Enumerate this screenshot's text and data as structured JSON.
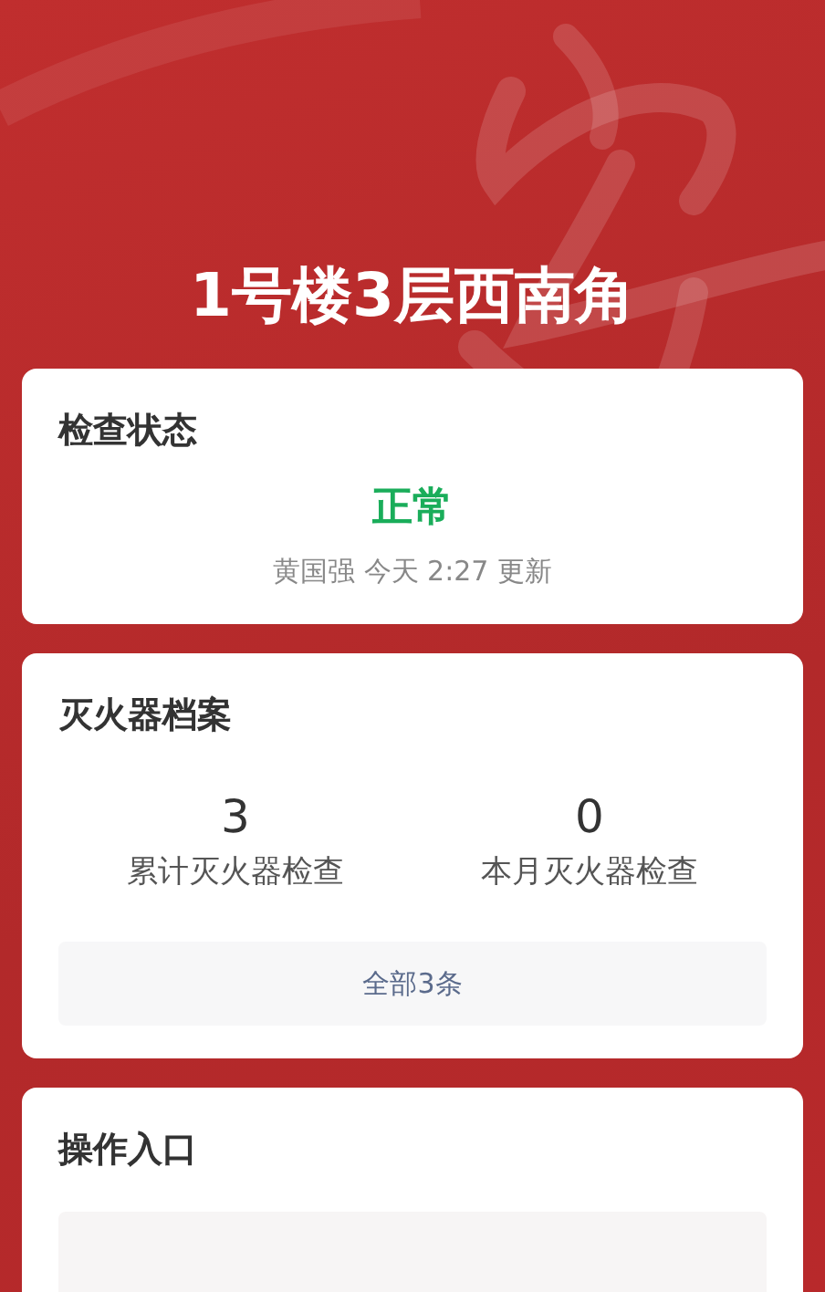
{
  "header": {
    "title": "1号楼3层西南角"
  },
  "inspection_status": {
    "title": "检查状态",
    "status": {
      "label": "正常",
      "kind": "normal"
    },
    "updated": "黄国强 今天 2:27 更新"
  },
  "extinguisher_records": {
    "title": "灭火器档案",
    "stats": [
      {
        "value": "3",
        "label": "累计灭火器检查"
      },
      {
        "value": "0",
        "label": "本月灭火器检查"
      }
    ],
    "button": "全部3条"
  },
  "operations": {
    "title": "操作入口"
  }
}
